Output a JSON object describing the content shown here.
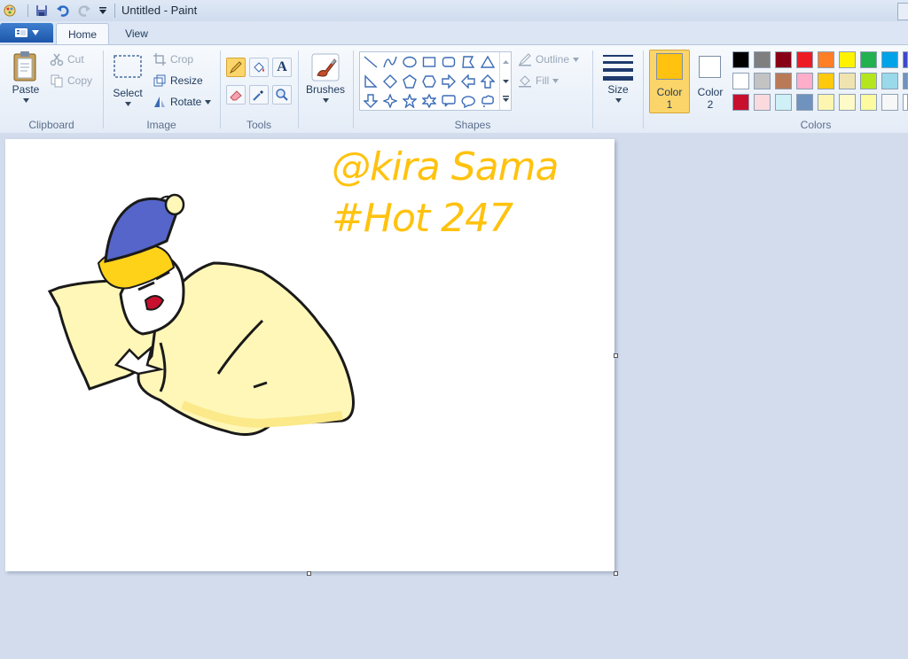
{
  "window": {
    "title": "Untitled - Paint"
  },
  "tabs": {
    "home": "Home",
    "view": "View"
  },
  "clipboard": {
    "paste": "Paste",
    "cut": "Cut",
    "copy": "Copy",
    "group": "Clipboard"
  },
  "image": {
    "select": "Select",
    "crop": "Crop",
    "resize": "Resize",
    "rotate": "Rotate",
    "group": "Image"
  },
  "tools": {
    "group": "Tools",
    "text_glyph": "A"
  },
  "brushes": {
    "label": "Brushes"
  },
  "shapes": {
    "group": "Shapes",
    "outline": "Outline",
    "fill": "Fill"
  },
  "size": {
    "label": "Size"
  },
  "colors": {
    "group": "Colors",
    "color1_label": "Color",
    "color1_num": "1",
    "color2_label": "Color",
    "color2_num": "2",
    "color1": "#ffc20e",
    "color2": "#ffffff",
    "palette_row1": [
      "#000000",
      "#7f7f7f",
      "#880015",
      "#ed1c24",
      "#ff7f27",
      "#fff200",
      "#22b14c",
      "#00a2e8"
    ],
    "palette_row2": [
      "#ffffff",
      "#c3c3c3",
      "#b97a57",
      "#ffaec9",
      "#ffc90e",
      "#efe4b0",
      "#b5e61d",
      "#99d9ea"
    ],
    "palette_row3": [
      "#c8102e",
      "#fadadd",
      "#d0f0f8",
      "#7092be",
      "#fef6b0",
      "#fefbc8",
      "#fefaa0",
      "#f7f7f7"
    ]
  },
  "drawing": {
    "line1": "@kira Sama",
    "line2": "#Hot 247",
    "ink_color": "#ffc20e"
  }
}
